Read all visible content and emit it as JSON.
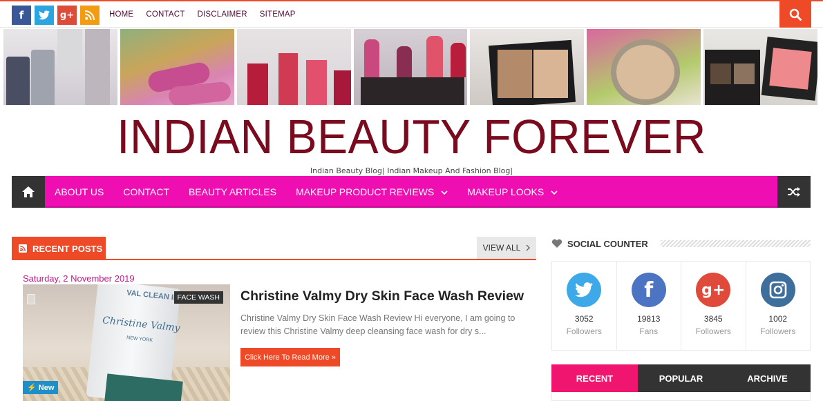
{
  "topbar": {
    "nav": [
      "HOME",
      "CONTACT",
      "DISCLAIMER",
      "SITEMAP"
    ],
    "social_icons": [
      "facebook-icon",
      "twitter-icon",
      "google-plus-icon",
      "rss-icon"
    ]
  },
  "site": {
    "title": "INDIAN BEAUTY FOREVER",
    "description": "Indian Beauty Blog| Indian Makeup And Fashion Blog|"
  },
  "mainnav": {
    "items": [
      "ABOUT US",
      "CONTACT",
      "BEAUTY ARTICLES",
      "MAKEUP PRODUCT REVIEWS",
      "MAKEUP LOOKS"
    ],
    "caret": "⌄"
  },
  "recent": {
    "heading": "RECENT POSTS",
    "view_all": "VIEW ALL"
  },
  "post": {
    "date": "Saturday, 2 November 2019",
    "tag": "FACE WASH",
    "new_label": "New",
    "title": "Christine Valmy Dry Skin Face Wash Review",
    "excerpt": "Christine Valmy Dry Skin Face Wash Review   Hi everyone, I am going to review this Christine Valmy deep cleansing face wash for dry s...",
    "read_more": "Click Here To Read More »",
    "thumb_text": {
      "brand": "VAL CLEAN II",
      "script": "Christine Valmy",
      "sub": "NEW YORK"
    }
  },
  "social_counter": {
    "heading": "SOCIAL COUNTER",
    "items": [
      {
        "icon": "twitter-icon",
        "count": "3052",
        "label": "Followers",
        "color": "#3ea9e8"
      },
      {
        "icon": "facebook-icon",
        "count": "19813",
        "label": "Fans",
        "color": "#4d74c3"
      },
      {
        "icon": "google-plus-icon",
        "count": "3845",
        "label": "Followers",
        "color": "#e04a3a"
      },
      {
        "icon": "instagram-icon",
        "count": "1002",
        "label": "Followers",
        "color": "#3d6e9c"
      }
    ]
  },
  "tabs": [
    "RECENT",
    "POPULAR",
    "ARCHIVE"
  ],
  "colors": {
    "accent": "#ef4a28",
    "nav": "#ef0eb2",
    "title": "#7a0a1d"
  }
}
